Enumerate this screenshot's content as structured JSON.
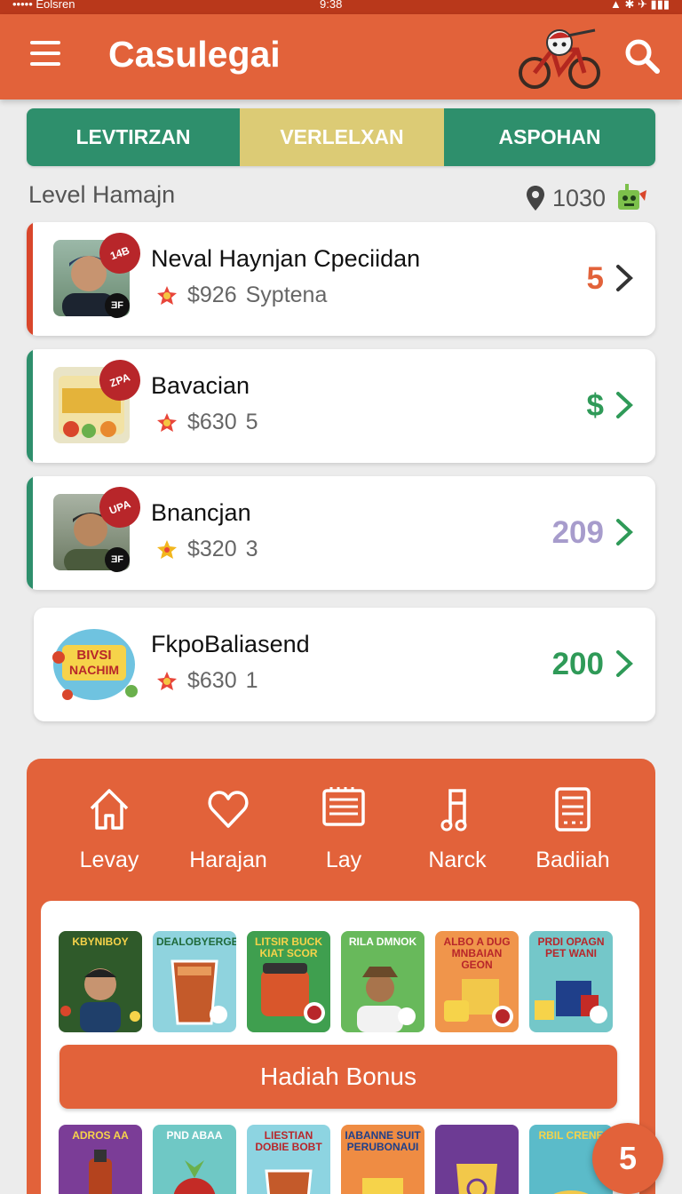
{
  "status_bar": {
    "left": "••••• Eolsren",
    "center": "9:38",
    "right": "▲ ✱ ✈ ▮▮▮"
  },
  "app": {
    "title": "Casulegai",
    "accent": "#e2623a",
    "tab_green": "#2e8f6c",
    "tab_gold": "#dccb75"
  },
  "tabs": [
    {
      "label": "LEVTIRZAN",
      "active": false
    },
    {
      "label": "VERLELXAN",
      "active": true
    },
    {
      "label": "ASPOHAN",
      "active": false
    }
  ],
  "section": {
    "label": "Level Hamajn",
    "location_value": "1030"
  },
  "list": [
    {
      "title": "Neval Haynjan Cpeciidan",
      "price": "$926",
      "meta": "Syptena",
      "value": "5",
      "value_color": "#e2623a",
      "badge": "14B",
      "stripe": "#d9462b",
      "icon": "flower-icon"
    },
    {
      "title": "Bavacian",
      "price": "$630",
      "meta": "5",
      "value": "$",
      "value_color": "#2f9a58",
      "badge": "ZPA",
      "stripe": "#2e8f6c",
      "icon": "flower-icon"
    },
    {
      "title": "Bnancjan",
      "price": "$320",
      "meta": "3",
      "value": "209",
      "value_color": "#a79ccc",
      "badge": "UPA",
      "stripe": "#2e8f6c",
      "icon": "star-icon"
    },
    {
      "title": "FkpoBaliasend",
      "price": "$630",
      "meta": "1",
      "value": "200",
      "value_color": "#2f9a58",
      "badge": "",
      "stripe": "",
      "icon": "flower-icon"
    }
  ],
  "nav": [
    {
      "label": "Levay",
      "icon": "home-icon"
    },
    {
      "label": "Harajan",
      "icon": "heart-icon"
    },
    {
      "label": "Lay",
      "icon": "notebook-icon"
    },
    {
      "label": "Narck",
      "icon": "music-note-icon"
    },
    {
      "label": "Badiiah",
      "icon": "calculator-icon"
    }
  ],
  "products_row1": [
    {
      "label": "KBYNIBOY",
      "bg": "#2f5a2a"
    },
    {
      "label": "DEALOBYERGE",
      "bg": "#8fd3de"
    },
    {
      "label": "LITSIR BUCK KIAT SCOR",
      "bg": "#3f9f4f"
    },
    {
      "label": "RILA DMNOK",
      "bg": "#68b95b"
    },
    {
      "label": "ALBO A DUG MNBAIAN GEON",
      "bg": "#f0954b"
    },
    {
      "label": "PRDI OPAGN PET WANI",
      "bg": "#74c7c9"
    }
  ],
  "bonus_button": "Hadiah Bonus",
  "products_row2": [
    {
      "label": "ADROS AA",
      "bg": "#7b3d97"
    },
    {
      "label": "PND ABAA",
      "bg": "#6fc8c5"
    },
    {
      "label": "LIESTIAN DOBIE BOBT",
      "bg": "#8dd4e1"
    },
    {
      "label": "IABANNE SUIT PERUBONAUI",
      "bg": "#ef8c43"
    },
    {
      "label": "",
      "bg": "#6d3b94"
    },
    {
      "label": "RBIL CRENE",
      "bg": "#5bbbc9"
    }
  ],
  "fab": "5"
}
